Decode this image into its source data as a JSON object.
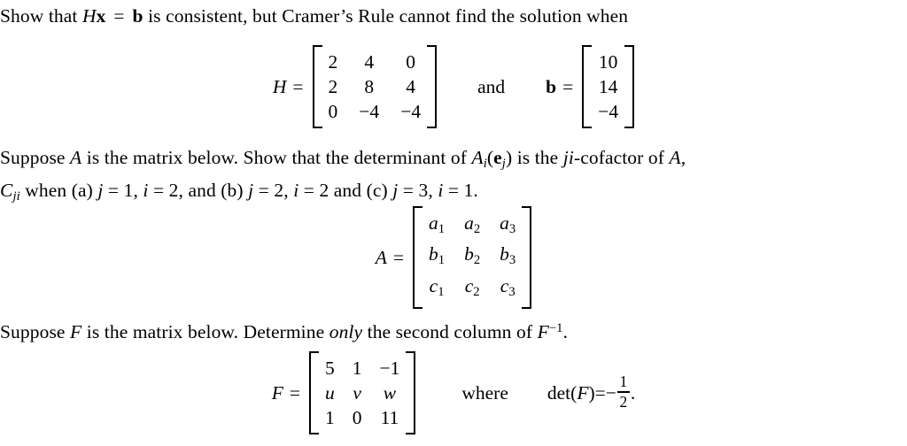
{
  "document": {
    "type": "math-exercise-sheet",
    "background_color": "#ffffff",
    "text_color": "#000000"
  },
  "problem1": {
    "statement_line1_part1": "Show that ",
    "statement_H": "H",
    "statement_x": "x",
    "statement_eq": " = ",
    "statement_b": "b",
    "statement_line1_part2": " is consistent, but Cramer’s Rule cannot find the solution when",
    "equation": {
      "H_label": "H",
      "equals": "=",
      "H_matrix": [
        [
          "2",
          "4",
          "0"
        ],
        [
          "2",
          "8",
          "4"
        ],
        [
          "0",
          "−4",
          "−4"
        ]
      ],
      "conjunction": "and",
      "b_label": "b",
      "b_equals": "=",
      "b_vector": [
        "10",
        "14",
        "−4"
      ]
    }
  },
  "problem2": {
    "line1_part1": "Suppose ",
    "line1_A": "A",
    "line1_part2": " is the matrix below.  Show that the determinant of ",
    "line1_Ai": "A",
    "line1_Ai_sub": "i",
    "line1_open": "(",
    "line1_e": "e",
    "line1_e_sub": "j",
    "line1_close": ")",
    "line1_part3": " is the ",
    "line1_ji": "ji",
    "line1_part4": "-cofactor of ",
    "line1_A2": "A",
    "line1_comma": ",",
    "line2_C": "C",
    "line2_C_sub": "ji",
    "line2_part1": " when (a) ",
    "line2_j1": "j",
    "line2_j1_val": " = 1",
    "line2_sep1": ", ",
    "line2_i1": "i",
    "line2_i1_val": " = 2",
    "line2_part2": ", and (b) ",
    "line2_j2": "j",
    "line2_j2_val": " = 2",
    "line2_sep2": ", ",
    "line2_i2": "i",
    "line2_i2_val": " = 2",
    "line2_part3": " and (c) ",
    "line2_j3": "j",
    "line2_j3_val": " = 3",
    "line2_sep3": ", ",
    "line2_i3": "i",
    "line2_i3_val": " = 1",
    "line2_end": ".",
    "equation": {
      "A_label": "A",
      "equals": "=",
      "A_matrix": [
        [
          {
            "base": "a",
            "sub": "1"
          },
          {
            "base": "a",
            "sub": "2"
          },
          {
            "base": "a",
            "sub": "3"
          }
        ],
        [
          {
            "base": "b",
            "sub": "1"
          },
          {
            "base": "b",
            "sub": "2"
          },
          {
            "base": "b",
            "sub": "3"
          }
        ],
        [
          {
            "base": "c",
            "sub": "1"
          },
          {
            "base": "c",
            "sub": "2"
          },
          {
            "base": "c",
            "sub": "3"
          }
        ]
      ]
    }
  },
  "problem3": {
    "line1_part1": "Suppose ",
    "line1_F": "F",
    "line1_part2": " is the matrix below.  Determine ",
    "line1_only": "only",
    "line1_part3": " the second column of ",
    "line1_Finv": "F",
    "line1_Finv_sup": "−1",
    "line1_end": ".",
    "equation": {
      "F_label": "F",
      "equals": "=",
      "F_matrix": [
        [
          {
            "v": "5",
            "italic": false
          },
          {
            "v": "1",
            "italic": false
          },
          {
            "v": "−1",
            "italic": false
          }
        ],
        [
          {
            "v": "u",
            "italic": true
          },
          {
            "v": "v",
            "italic": true
          },
          {
            "v": "w",
            "italic": true
          }
        ],
        [
          {
            "v": "1",
            "italic": false
          },
          {
            "v": "0",
            "italic": false
          },
          {
            "v": "11",
            "italic": false
          }
        ]
      ],
      "where": "where",
      "det_label": "det(",
      "det_F": "F",
      "det_close": ")",
      "det_equals": " = ",
      "det_minus": "−",
      "det_numerator": "1",
      "det_denominator": "2",
      "det_period": "."
    }
  }
}
